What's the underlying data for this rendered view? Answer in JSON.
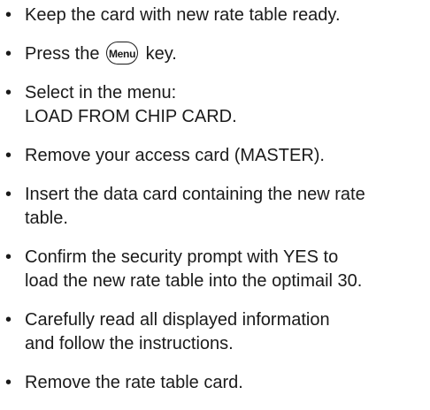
{
  "steps": [
    {
      "lines": [
        "Keep the card with new rate table ready."
      ]
    },
    {
      "before": "Press the",
      "key": "Menu",
      "after": "key."
    },
    {
      "lines": [
        "Select in the menu:",
        "LOAD FROM CHIP CARD."
      ]
    },
    {
      "lines": [
        "Remove your access card (MASTER)."
      ]
    },
    {
      "lines": [
        "Insert the data card containing the new rate",
        "table."
      ]
    },
    {
      "lines": [
        "Confirm the security prompt with YES to",
        "load the new rate table into the optimail 30."
      ]
    },
    {
      "lines": [
        "Carefully read all displayed information",
        "and follow the instructions."
      ]
    },
    {
      "lines": [
        "Remove the rate table card."
      ]
    }
  ],
  "icons": {
    "bullet": "bullet-dot",
    "menu_key": "menu-key-icon"
  }
}
